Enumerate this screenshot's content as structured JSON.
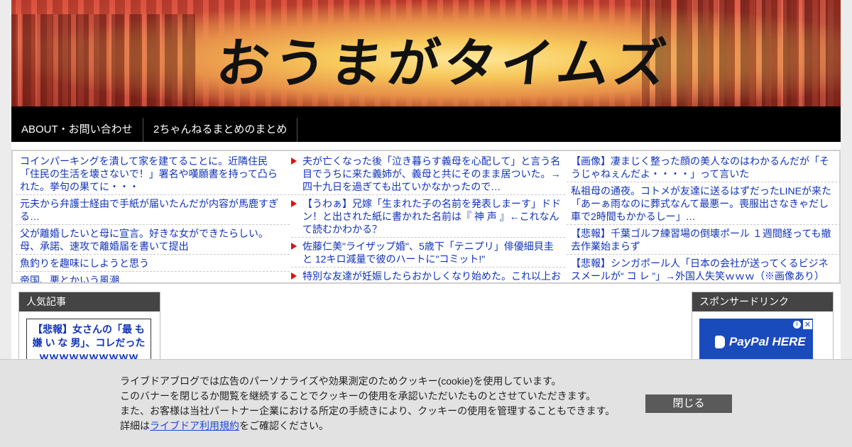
{
  "header": {
    "site_title": "おうまがタイムズ"
  },
  "nav": {
    "items": [
      {
        "label": "ABOUT・お問い合わせ"
      },
      {
        "label": "2ちゃんねるまとめのまとめ"
      }
    ]
  },
  "feed": {
    "column1": [
      "コインパーキングを潰して家を建てることに。近隣住民「住民の生活を壊さないで！」署名や嘆願書を持って凸られた。挙句の果てに・・・",
      "元夫から弁護士経由で手紙が届いたんだが内容が馬鹿すぎる…",
      "父が離婚したいと母に宣言。好きな女ができたらしい。母、承諾、速攻で離婚届を書いて提出",
      "魚釣りを趣味にしようと思う",
      "帝国、悪とかいう風潮"
    ],
    "column2": [
      "夫が亡くなった後「泣き暮らす義母を心配して」と言う名目でうちに来た義姉が、義母と共にそのまま居ついた。→四十九日を過ぎても出ていかなかったので…",
      "【うわぁ】兄嫁「生まれた子の名前を発表しまーす」ドドン！と出された紙に書かれた名前は『 神 声 』←これなんて読むかわかる？",
      "佐藤仁美\"ライザップ婚\"、5歳下「テニプリ」俳優細貝圭と 12キロ減量で彼のハートに\"コミット!\"",
      "特別な友達が妊娠したらおかしくなり始めた。これ以上お"
    ],
    "column3": [
      "【画像】凄まじく整った顔の美人なのはわかるんだが「そうじゃねぇんだよ・・・・」って言いた",
      "私祖母の通夜。コトメが友達に送るはずだったLINEが来た「あーぁ雨なのに葬式なんて最悪ー。喪服出さなきゃだし車で2時間もかかるしー」…",
      "【悲報】千葉ゴルフ練習場の倒壊ポール １週間経っても撤去作業始まらず",
      "【悲報】シンガポール人「日本の会社が送ってくるビジネスメールが“ コ レ ”」→外国人失笑ｗｗｗ（※画像あり）"
    ]
  },
  "sidebar_left": {
    "heading": "人気記事",
    "article": "【悲報】女さんの「最 も 嫌 い な 男」、コレだったｗｗｗｗｗｗｗｗｗｗ"
  },
  "sidebar_right": {
    "heading": "スポンサードリンク",
    "ad_text": "PayPal HERE",
    "ad_info": "i",
    "ad_close": "✕"
  },
  "cookie_banner": {
    "line1": "ライブドアブログでは広告のパーソナライズや効果測定のためクッキー(cookie)を使用しています。",
    "line2": "このバナーを閉じるか閲覧を継続することでクッキーの使用を承認いただいたものとさせていただきます。",
    "line3": "また、お客様は当社パートナー企業における所定の手続きにより、クッキーの使用を管理することもできます。",
    "line4_prefix": "詳細は",
    "line4_link": "ライブドア利用規約",
    "line4_suffix": "をご確認ください。",
    "close_label": "閉じる"
  },
  "colors": {
    "link": "#1133bb",
    "nav_bg": "#000000",
    "marker": "#e01010",
    "widget_head": "#444444",
    "close_button": "#5a5a5a"
  }
}
